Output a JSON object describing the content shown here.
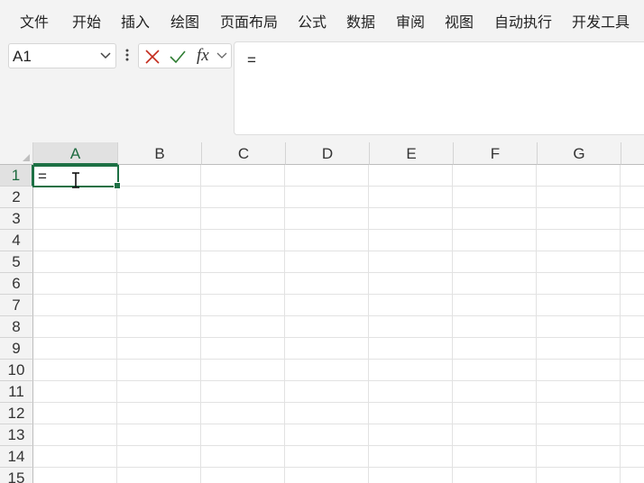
{
  "menu": {
    "items": [
      "文件",
      "开始",
      "插入",
      "绘图",
      "页面布局",
      "公式",
      "数据",
      "审阅",
      "视图",
      "自动执行",
      "开发工具"
    ]
  },
  "formula_bar": {
    "name_box": "A1",
    "fx_label": "fx",
    "content": "="
  },
  "grid": {
    "columns": [
      "A",
      "B",
      "C",
      "D",
      "E",
      "F",
      "G"
    ],
    "rows": [
      "1",
      "2",
      "3",
      "4",
      "5",
      "6",
      "7",
      "8",
      "9",
      "10",
      "11",
      "12",
      "13",
      "14",
      "15"
    ],
    "active_cell": {
      "ref": "A1",
      "value": "="
    }
  },
  "icons": {
    "name_box_dropdown": "chevron-down-icon",
    "more": "vertical-dots-icon",
    "cancel": "close-icon",
    "enter": "checkmark-icon",
    "insert_function": "fx-icon",
    "formula_expand": "chevron-down-icon",
    "select_all": "select-all-triangle-icon",
    "cursor": "text-cursor-icon"
  },
  "colors": {
    "accent_green": "#1d7044",
    "cancel_red": "#c42b1c",
    "enter_green": "#2e7d32",
    "chrome_bg": "#f3f3f3",
    "gridline": "#e2e2e2"
  }
}
